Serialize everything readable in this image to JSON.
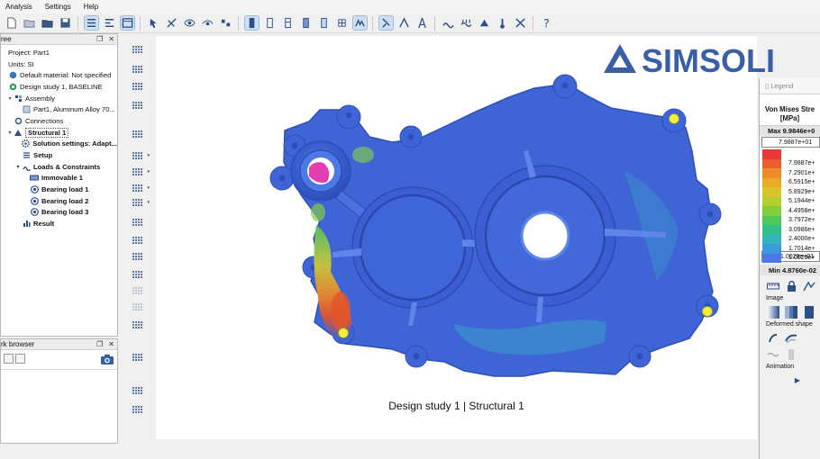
{
  "menu": [
    "Analysis",
    "Settings",
    "Help"
  ],
  "tree_panel": {
    "title": "ree",
    "items": [
      {
        "label": "Project: Part1",
        "indent": 0,
        "expander": "",
        "icon": "",
        "bold": false
      },
      {
        "label": "Units: SI",
        "indent": 0,
        "expander": "",
        "icon": "",
        "bold": false
      },
      {
        "label": "Default material: Not specified",
        "indent": 0,
        "expander": "",
        "icon": "material-icon",
        "bold": false
      },
      {
        "label": "Design study 1, BASELINE",
        "indent": 0,
        "expander": "",
        "icon": "design-study-icon",
        "bold": false
      },
      {
        "label": "Assembly",
        "indent": 1,
        "expander": "▾",
        "icon": "assembly-icon",
        "bold": false
      },
      {
        "label": "Part1, Aluminum Alloy 70...",
        "indent": 2,
        "expander": "",
        "icon": "part-icon",
        "bold": false
      },
      {
        "label": "Connections",
        "indent": 1,
        "expander": "",
        "icon": "connections-icon",
        "bold": false
      },
      {
        "label": "Structural  1",
        "indent": 1,
        "expander": "▾",
        "icon": "structural-icon",
        "bold": true
      },
      {
        "label": "Solution settings: Adapt...",
        "indent": 2,
        "expander": "",
        "icon": "gear-icon",
        "bold": true
      },
      {
        "label": "Setup",
        "indent": 2,
        "expander": "",
        "icon": "setup-icon",
        "bold": true
      },
      {
        "label": "Loads & Constraints",
        "indent": 2,
        "expander": "▾",
        "icon": "loads-icon",
        "bold": true
      },
      {
        "label": "Immovable 1",
        "indent": 3,
        "expander": "",
        "icon": "constraint-icon",
        "bold": true
      },
      {
        "label": "Bearing load 1",
        "indent": 3,
        "expander": "",
        "icon": "bearing-load-icon",
        "bold": true
      },
      {
        "label": "Bearing load 2",
        "indent": 3,
        "expander": "",
        "icon": "bearing-load-icon",
        "bold": true
      },
      {
        "label": "Bearing load 3",
        "indent": 3,
        "expander": "",
        "icon": "bearing-load-icon",
        "bold": true
      },
      {
        "label": "Result",
        "indent": 2,
        "expander": "",
        "icon": "result-icon",
        "bold": true
      }
    ]
  },
  "browser_panel": {
    "title": "rk browser"
  },
  "viewport": {
    "caption": "Design study 1 | Structural  1",
    "logo_text": "SIMSOLI"
  },
  "legend": {
    "tab": "Legend",
    "title_line1": "Von Mises Stre",
    "title_line2": "[MPa]",
    "max_label": "Max  9.9846e+0",
    "max_value": "7.9887e+01",
    "min_value": "1.0029e+01",
    "min_label": "Min  4.8760e-02",
    "scale": [
      {
        "color": "#e8383a",
        "value": ""
      },
      {
        "color": "#ee5d2e",
        "value": "7.9887e+"
      },
      {
        "color": "#ef8a2a",
        "value": "7.2901e+"
      },
      {
        "color": "#e8ab29",
        "value": "6.5915e+"
      },
      {
        "color": "#d8c52b",
        "value": "5.8929e+"
      },
      {
        "color": "#b1cf2f",
        "value": "5.1944e+"
      },
      {
        "color": "#82cc3d",
        "value": "4.4958e+"
      },
      {
        "color": "#4fc759",
        "value": "3.7972e+"
      },
      {
        "color": "#32bf8a",
        "value": "3.0986e+"
      },
      {
        "color": "#33b6bb",
        "value": "2.4000e+"
      },
      {
        "color": "#3d98de",
        "value": "1.7014e+"
      },
      {
        "color": "#4a78e8",
        "value": "1.0029e+"
      }
    ],
    "image_label": "Image",
    "deformed_label": "Deformed shape",
    "animation_label": "Animation",
    "play_label": "▶"
  },
  "colors": {
    "part_blue": "#3f64d6",
    "accent_blue": "#3069b5",
    "logo": "#3b5fa6"
  }
}
